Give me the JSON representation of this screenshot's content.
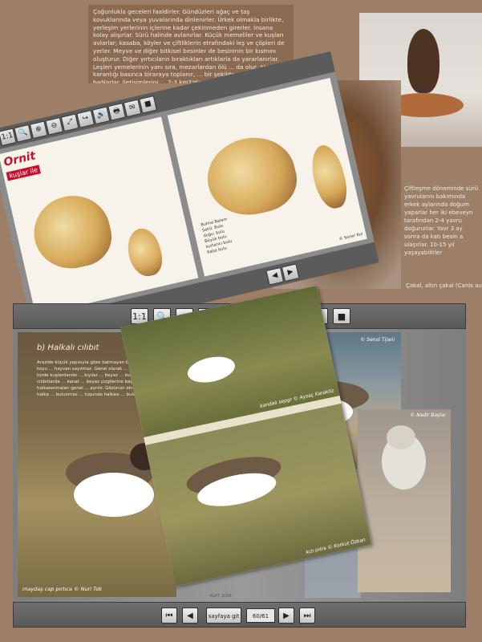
{
  "background": {
    "text_block": "Çoğunlukla geceleri faaldirler. Gündüzleri ağaç ve taş kovuklarında veya yuvalarında dinlenirler. Ürkek olmakla birlikte, yerleşim yerlerinin içlerine kadar çekinmeden girerler. İnsana kolay alışırlar. Sürü halinde avlanırlar. Küçük memeliler ve kuşları avlarlar; kasaba, köyler ve çiftliklerin etrafındaki leş ve çöpleri de yerler. Meyve ve diğer bitkisel besinler de besininin bir kısmını oluşturur. Diğer yırtıcıların bıraktıkları artıklarla da yararlanırlar. Leşleri yemelerinin yanı sıra, mezarlardan ölü ... da olur. Akşam karanlığı basınca biraraya toplanır, ... bir şekilde ulumaya bağlarlar. İletişimlerini ... 2-3 km2'dir. Bu alan idrarla işa... Kuduz mikrobu taşıyabildikleri ...",
    "side_text": "Çiftleşme döneminde sürü yavrularını bakımında erkek aylarında doğum yaparlar her iki ebeveyn tarafından 2-4 yavru doğururlar. Yavr 3 ay sonra da katı besin a ulaşırlar. 10-15 yıl yaşayabilirler",
    "caption": "Çakal, altın çakal (Canis au"
  },
  "small_viewer": {
    "brand": "kuşlar ile",
    "sketch_notes": "Bulma Balam\nSahil: Bulo\ndoğu: bulu\nBüyük bulu\nkurtarıcı bulu\nKaba bulu",
    "sketch_credit": "© Soner Kul",
    "toolbar": [
      "1:1",
      "🔍",
      "⊕",
      "⊖",
      "⤢",
      "↪",
      "🔊",
      "🖶",
      "✉",
      "■"
    ]
  },
  "main_viewer": {
    "toolbar": {
      "fit_label": "1:1",
      "zoom_label": "🔍",
      "zoom_in_label": "⊕",
      "zoom_out_label": "⊖",
      "fullscreen_label": "⤢",
      "flip_label": "↪",
      "sound_label": "🔊",
      "print_label": "🖶",
      "email_label": "✉",
      "stop_label": "■"
    },
    "left_page": {
      "title": "b) Halkalı cılıbıt",
      "body": "Arazide küçük yapısıyla göze batmayan bir kuş ... koyu ... hayvan sayılmaz. Genel olarak ... kum ve ... türde kuşlardandır ... kıyılar ... beyaz ... kum ... halkalı cılıbıtlarda ... kanat ... beyaz çizgilerine bağlı ... halkalanmaları genel ... ayrılır. Gözünün etrafında sarı halka ... bulunmaz ... tuşunda halkası ... bulunabilir ...",
      "caption": "maydaş cap pırtıca © Nuri Tok"
    },
    "mid_page": {
      "top_caption": "kandalı sepgr © Aysaç Karaköz",
      "bottom_caption": "kızı pıtra © Korkut Özkan"
    },
    "right_page": {
      "top_copy": "© Senol Tijani",
      "bottom_copy": "© Nadir Başlar"
    },
    "footer_label": "KuPT 2009",
    "nav": {
      "first_label": "⏮",
      "prev_label": "◀",
      "goto_label": "sayfaya git",
      "page_counter": "60/61",
      "next_label": "▶",
      "last_label": "⏭"
    }
  }
}
